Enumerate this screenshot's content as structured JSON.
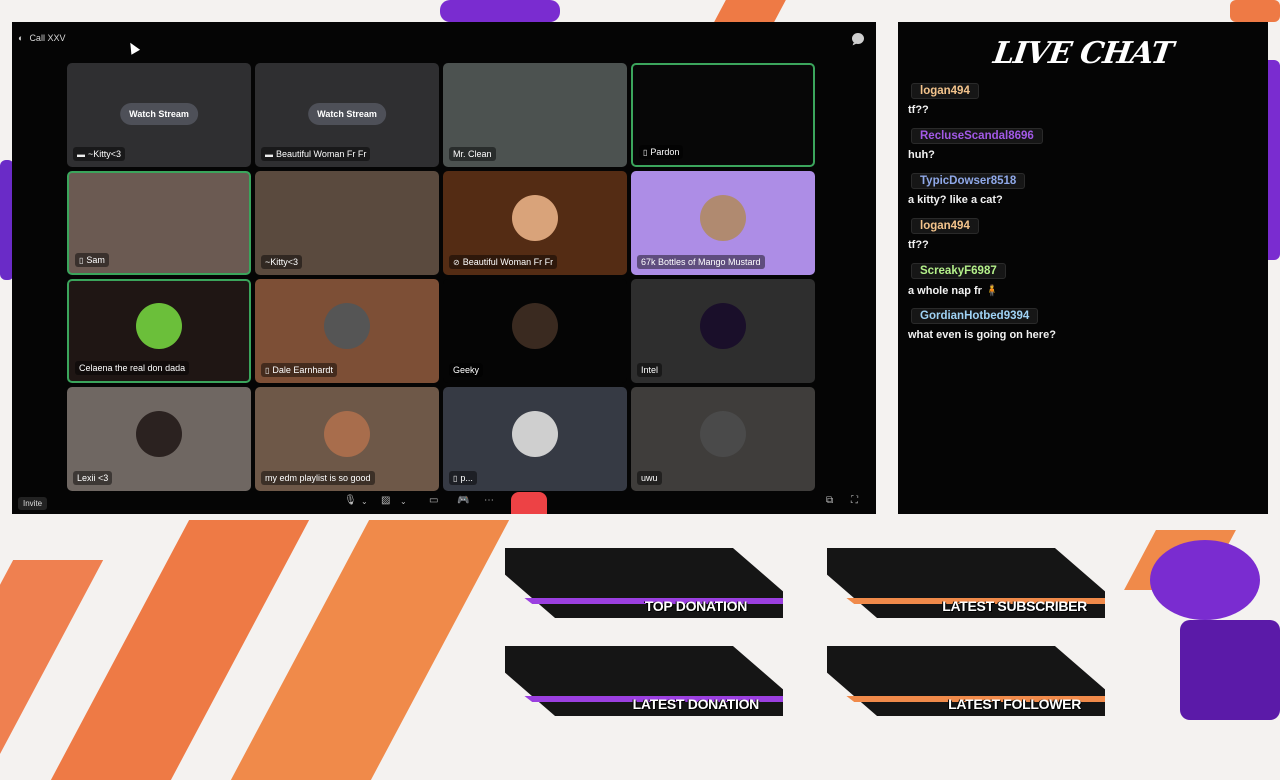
{
  "call": {
    "title": "Call XXV",
    "invite_label": "Invite",
    "tiles": [
      {
        "name": "~Kitty<3",
        "icon": "screen-share-icon",
        "watch": "Watch Stream",
        "bg": "#2f2f31",
        "speaking": false
      },
      {
        "name": "Beautiful Woman Fr Fr",
        "icon": "screen-share-icon",
        "watch": "Watch Stream",
        "bg": "#2f2f31",
        "speaking": false
      },
      {
        "name": "Mr. Clean",
        "icon": "",
        "watch": "",
        "bg": "#4c5250",
        "speaking": false
      },
      {
        "name": "Pardon",
        "icon": "phone-icon",
        "watch": "",
        "bg": "#070707",
        "speaking": true
      },
      {
        "name": "Sam",
        "icon": "phone-icon",
        "watch": "",
        "bg": "#6b5a52",
        "speaking": true
      },
      {
        "name": "~Kitty<3",
        "icon": "",
        "watch": "",
        "bg": "#5a4a3e",
        "speaking": false
      },
      {
        "name": "Beautiful Woman Fr Fr",
        "icon": "video-off-icon",
        "watch": "",
        "bg": "#542c14",
        "speaking": false
      },
      {
        "name": "67k Bottles of Mango Mustard",
        "icon": "",
        "watch": "",
        "bg": "#ad8de6",
        "speaking": false
      },
      {
        "name": "Celaena the real don dada",
        "icon": "",
        "watch": "",
        "bg": "#1f1614",
        "speaking": true
      },
      {
        "name": "Dale Earnhardt",
        "icon": "phone-icon",
        "watch": "",
        "bg": "#7d4f36",
        "speaking": false
      },
      {
        "name": "Geeky",
        "icon": "",
        "watch": "",
        "bg": "#050505",
        "speaking": false
      },
      {
        "name": "Intel",
        "icon": "",
        "watch": "",
        "bg": "#2e2e2e",
        "speaking": false
      },
      {
        "name": "Lexii <3",
        "icon": "",
        "watch": "",
        "bg": "#6f6762",
        "speaking": false
      },
      {
        "name": "my edm playlist is so good",
        "icon": "",
        "watch": "",
        "bg": "#6e5848",
        "speaking": false
      },
      {
        "name": "p...",
        "icon": "phone-icon",
        "watch": "",
        "bg": "#363a44",
        "speaking": false
      },
      {
        "name": "uwu",
        "icon": "",
        "watch": "",
        "bg": "#3f3d3b",
        "speaking": false
      }
    ]
  },
  "chat": {
    "title": "LIVE CHAT",
    "messages": [
      {
        "user": "logan494",
        "color": "#f4c48c",
        "text": "tf??"
      },
      {
        "user": "RecluseScandal8696",
        "color": "#a259e6",
        "text": "huh?"
      },
      {
        "user": "TypicDowser8518",
        "color": "#8fa8e8",
        "text": "a kitty? like a cat?"
      },
      {
        "user": "logan494",
        "color": "#f4c48c",
        "text": "tf??"
      },
      {
        "user": "ScreakyF6987",
        "color": "#b4f08a",
        "text": "a whole nap fr 🧍"
      },
      {
        "user": "GordianHotbed9394",
        "color": "#9fd2f4",
        "text": "what even is going on here?"
      }
    ]
  },
  "overlay": {
    "top_donation": "TOP DONATION",
    "latest_subscriber": "LATEST SUBSCRIBER",
    "latest_donation": "LATEST DONATION",
    "latest_follower": "LATEST FOLLOWER"
  },
  "colors": {
    "accent_purple": "#9b3fe0",
    "accent_orange": "#f08040",
    "speaking_green": "#3ba55c",
    "hangup_red": "#ed4245"
  }
}
